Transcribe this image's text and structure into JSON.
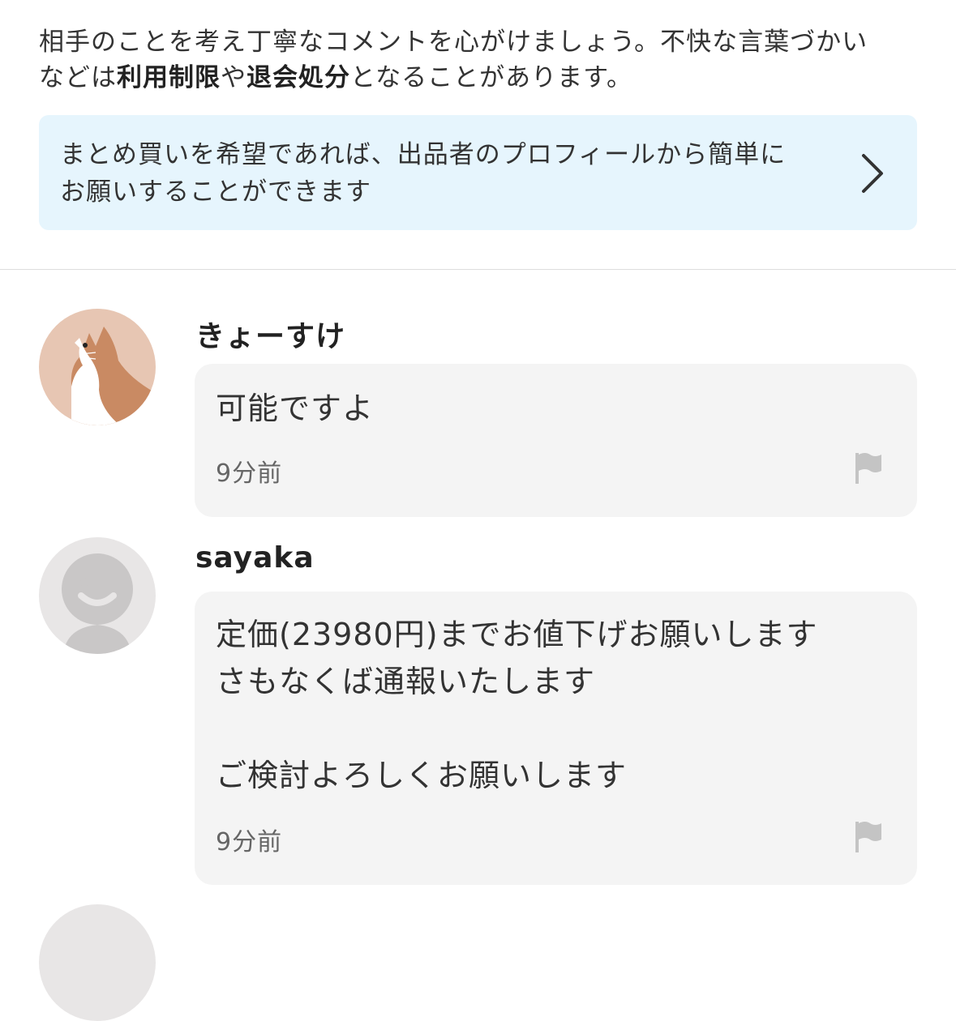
{
  "notice": {
    "line1": "相手のことを考え丁寧なコメントを心がけましょう。不快な言葉づかい",
    "line2_prefix": "などは",
    "bold1": "利用制限",
    "mid": "や",
    "bold2": "退会処分",
    "line2_suffix": "となることがあります。"
  },
  "banner": {
    "line1": "まとめ買いを希望であれば、出品者のプロフィールから簡単に",
    "line2": "お願いすることができます",
    "icon": "chevron-right-icon",
    "bg": "#e6f5fd"
  },
  "comments": [
    {
      "user": "きょーすけ",
      "avatar": "cat-avatar",
      "message": "可能ですよ",
      "time": "9分前",
      "flag_icon": "flag-icon"
    },
    {
      "user": "sayaka",
      "avatar": "default-avatar",
      "message": "定価(23980円)までお値下げお願いします\nさもなくば通報いたします\n\nご検討よろしくお願いします",
      "time": "9分前",
      "flag_icon": "flag-icon"
    }
  ],
  "colors": {
    "bubble_bg": "#f4f4f4",
    "divider": "#dddddd",
    "text": "#333333"
  }
}
